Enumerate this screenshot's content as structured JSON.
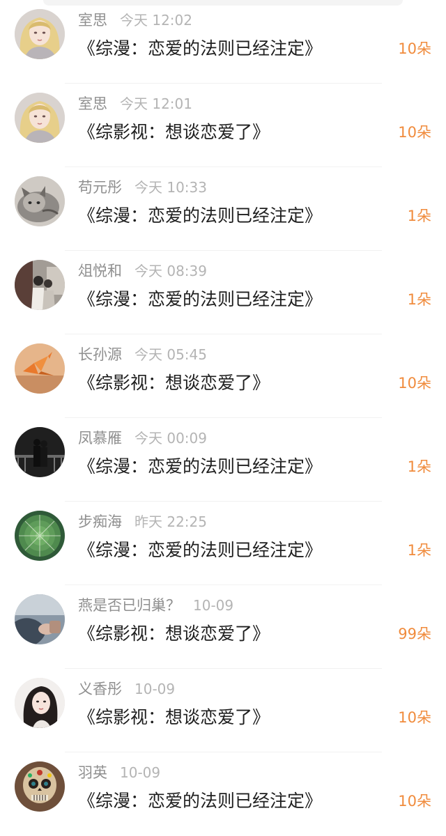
{
  "comments": [
    {
      "name": "室思",
      "time": "今天 12:02",
      "title": "《综漫：恋爱的法则已经注定》",
      "gift": "10朵",
      "avatar_icon": "anime-girl-avatar"
    },
    {
      "name": "室思",
      "time": "今天 12:01",
      "title": "《综影视：想谈恋爱了》",
      "gift": "10朵",
      "avatar_icon": "anime-girl-avatar"
    },
    {
      "name": "苟元彤",
      "time": "今天 10:33",
      "title": "《综漫：恋爱的法则已经注定》",
      "gift": "1朵",
      "avatar_icon": "cat-avatar"
    },
    {
      "name": "俎悦和",
      "time": "今天 08:39",
      "title": "《综漫：恋爱的法则已经注定》",
      "gift": "1朵",
      "avatar_icon": "couple-photo-avatar"
    },
    {
      "name": "长孙源",
      "time": "今天 05:45",
      "title": "《综影视：想谈恋爱了》",
      "gift": "10朵",
      "avatar_icon": "paper-crane-avatar"
    },
    {
      "name": "凤慕雁",
      "time": "今天 00:09",
      "title": "《综漫：恋爱的法则已经注定》",
      "gift": "1朵",
      "avatar_icon": "night-couple-avatar"
    },
    {
      "name": "步痴海",
      "time": "昨天 22:25",
      "title": "《综漫：恋爱的法则已经注定》",
      "gift": "1朵",
      "avatar_icon": "cactus-avatar"
    },
    {
      "name": "燕是否已归巢？",
      "time": "10-09",
      "title": "《综影视：想谈恋爱了》",
      "gift": "99朵",
      "avatar_icon": "hand-photo-avatar"
    },
    {
      "name": "义香彤",
      "time": "10-09",
      "title": "《综影视：想谈恋爱了》",
      "gift": "10朵",
      "avatar_icon": "girl-portrait-avatar"
    },
    {
      "name": "羽英",
      "time": "10-09",
      "title": "《综漫：恋爱的法则已经注定》",
      "gift": "10朵",
      "avatar_icon": "sugar-skull-avatar"
    }
  ],
  "colors": {
    "name": "#8f8f8f",
    "time": "#b4b4b4",
    "title": "#1e1e1e",
    "gift": "#f08b3c"
  }
}
